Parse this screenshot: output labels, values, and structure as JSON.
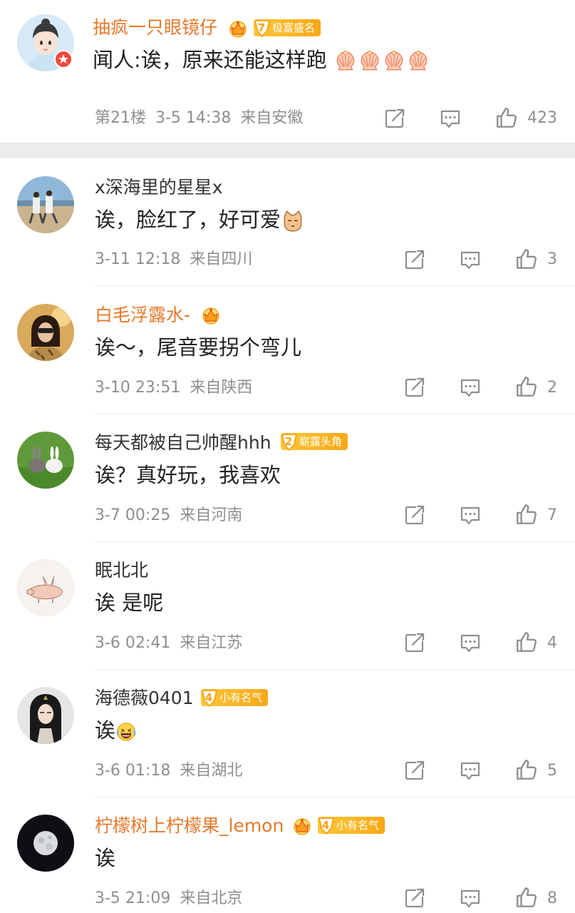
{
  "top_comment": {
    "author": "抽疯一只眼镜仔",
    "badge": {
      "level": "7",
      "label": "极富盛名"
    },
    "text": "闻人:诶，原来还能这样跑",
    "floor": "第21楼",
    "time": "3-5 14:38",
    "location": "来自安徽",
    "likes": "423"
  },
  "replies": [
    {
      "author": "x深海里的星星x",
      "vip": false,
      "text": "诶，脸红了，好可爱",
      "time": "3-11 12:18",
      "location": "来自四川",
      "likes": "3"
    },
    {
      "author": "白毛浮露水-",
      "vip": true,
      "text": "诶～，尾音要拐个弯儿",
      "time": "3-10 23:51",
      "location": "来自陕西",
      "likes": "2"
    },
    {
      "author": "每天都被自己帅醒hhh",
      "vip": false,
      "badge": {
        "level": "2",
        "label": "崭露头角"
      },
      "text": "诶？真好玩，我喜欢",
      "time": "3-7 00:25",
      "location": "来自河南",
      "likes": "7"
    },
    {
      "author": "眠北北",
      "vip": false,
      "text": "诶 是呢",
      "time": "3-6 02:41",
      "location": "来自江苏",
      "likes": "4"
    },
    {
      "author": "海德薇0401",
      "vip": false,
      "badge": {
        "level": "4",
        "label": "小有名气"
      },
      "text": "诶",
      "time": "3-6 01:18",
      "location": "来自湖北",
      "likes": "5"
    },
    {
      "author": "柠檬树上柠檬果_lemon",
      "vip": true,
      "badge": {
        "level": "4",
        "label": "小有名气"
      },
      "text": "诶",
      "time": "3-5 21:09",
      "location": "来自北京",
      "likes": "8"
    }
  ],
  "colors": {
    "vip_name": "#e8792c",
    "meta": "#8e8e8e",
    "badge": "#f7a816",
    "separator": "#ececec"
  },
  "icons": [
    "share-icon",
    "comment-icon",
    "like-icon",
    "crown-icon",
    "level-badge-icon",
    "shell-emoji",
    "cat-emoji",
    "laugh-emoji"
  ]
}
